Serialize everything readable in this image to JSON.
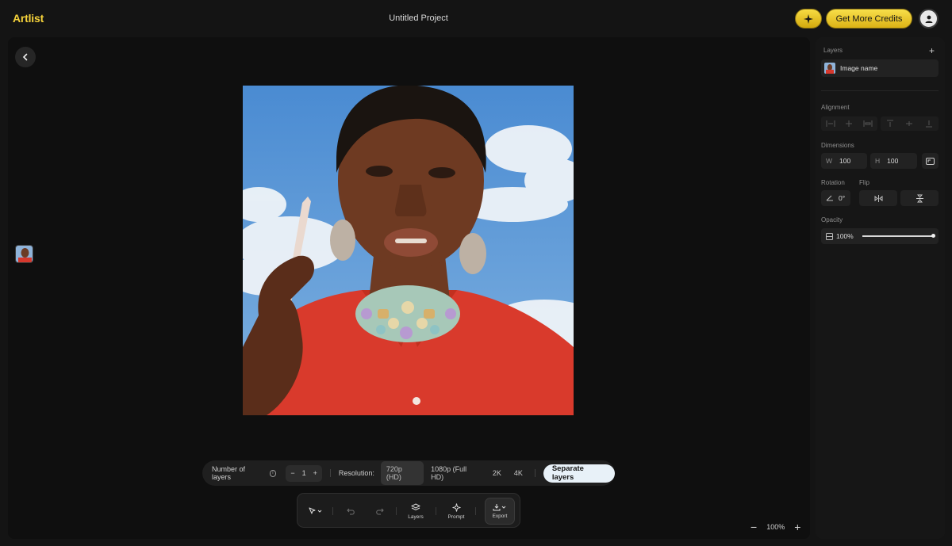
{
  "app": {
    "logo": "Artlist",
    "project_title": "Untitled Project"
  },
  "header": {
    "credits_label": "Get More Credits"
  },
  "options": {
    "layers_label": "Number of layers",
    "layers_value": "1",
    "minus": "−",
    "plus": "+",
    "resolution_label": "Resolution:",
    "resolutions": [
      "720p (HD)",
      "1080p (Full HD)",
      "2K",
      "4K"
    ],
    "selected_resolution": "720p (HD)",
    "separate_label": "Separate layers"
  },
  "toolbar": {
    "layers_label": "Layers",
    "prompt_label": "Prompt",
    "export_label": "Export"
  },
  "zoom": {
    "minus": "−",
    "value": "100%",
    "plus": "+"
  },
  "panel": {
    "layers_title": "Layers",
    "add": "+",
    "layer_name": "Image name",
    "alignment_title": "Alignment",
    "dimensions_title": "Dimensions",
    "width_prefix": "W",
    "width_value": "100",
    "height_prefix": "H",
    "height_value": "100",
    "rotation_title": "Rotation",
    "flip_title": "Flip",
    "rotation_value": "0°",
    "opacity_title": "Opacity",
    "opacity_value": "100%",
    "opacity_level": 1.0
  },
  "colors": {
    "accent": "#f6d33b",
    "background": "#141414",
    "canvas": "#0f0f0f"
  },
  "icons": [
    "sparkle-icon",
    "user-icon",
    "chevron-left-icon",
    "info-icon",
    "pointer-icon",
    "undo-icon",
    "redo-icon",
    "layers-icon",
    "prompt-sparkle-icon",
    "download-icon",
    "align-left-icon",
    "align-center-h-icon",
    "align-right-icon",
    "align-top-icon",
    "align-center-v-icon",
    "align-bottom-icon",
    "aspect-lock-icon",
    "angle-icon",
    "flip-horizontal-icon",
    "flip-vertical-icon",
    "opacity-icon"
  ]
}
